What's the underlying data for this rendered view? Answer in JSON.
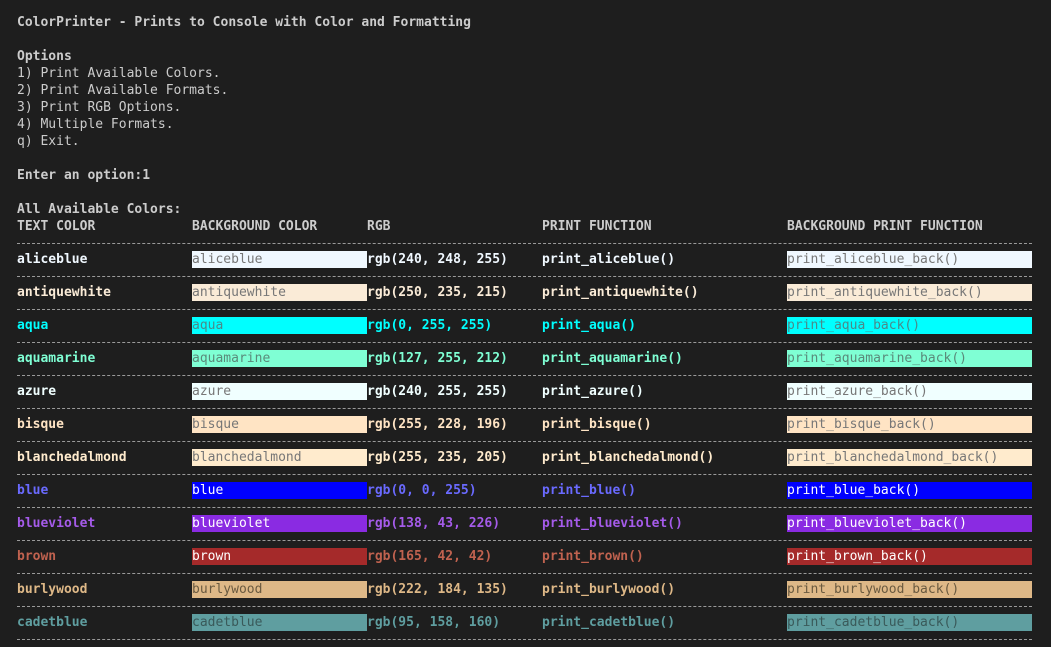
{
  "console": {
    "title": "ColorPrinter - Prints to Console with Color and Formatting",
    "options_heading": "Options",
    "options": [
      "1) Print Available Colors.",
      "2) Print Available Formats.",
      "3) Print RGB Options.",
      "4) Multiple Formats.",
      "q) Exit."
    ],
    "prompt": "Enter an option:1",
    "section_title": "All Available Colors:",
    "headers": [
      "TEXT COLOR",
      "BACKGROUND COLOR",
      "RGB",
      "PRINT FUNCTION",
      "BACKGROUND PRINT FUNCTION"
    ],
    "colors": [
      {
        "name": "aliceblue",
        "rgb": "rgb(240, 248, 255)",
        "print_fn": "print_aliceblue()",
        "back_fn": "print_aliceblue_back()",
        "hex": "#f0f8ff",
        "bg_text": "#777777"
      },
      {
        "name": "antiquewhite",
        "rgb": "rgb(250, 235, 215)",
        "print_fn": "print_antiquewhite()",
        "back_fn": "print_antiquewhite_back()",
        "hex": "#faebd7",
        "bg_text": "#777777"
      },
      {
        "name": "aqua",
        "rgb": "rgb(0, 255, 255)",
        "print_fn": "print_aqua()",
        "back_fn": "print_aqua_back()",
        "hex": "#00ffff",
        "bg_text": "#4a8a8a"
      },
      {
        "name": "aquamarine",
        "rgb": "rgb(127, 255, 212)",
        "print_fn": "print_aquamarine()",
        "back_fn": "print_aquamarine_back()",
        "hex": "#7fffd4",
        "bg_text": "#5a8a7a"
      },
      {
        "name": "azure",
        "rgb": "rgb(240, 255, 255)",
        "print_fn": "print_azure()",
        "back_fn": "print_azure_back()",
        "hex": "#f0ffff",
        "bg_text": "#777777"
      },
      {
        "name": "bisque",
        "rgb": "rgb(255, 228, 196)",
        "print_fn": "print_bisque()",
        "back_fn": "print_bisque_back()",
        "hex": "#ffe4c4",
        "bg_text": "#777777"
      },
      {
        "name": "blanchedalmond",
        "rgb": "rgb(255, 235, 205)",
        "print_fn": "print_blanchedalmond()",
        "back_fn": "print_blanchedalmond_back()",
        "hex": "#ffebcd",
        "bg_text": "#777777"
      },
      {
        "name": "blue",
        "rgb": "rgb(0, 0, 255)",
        "print_fn": "print_blue()",
        "back_fn": "print_blue_back()",
        "hex": "#0000ff",
        "fg": "#6a6aff",
        "bg_text": "#dddddd"
      },
      {
        "name": "blueviolet",
        "rgb": "rgb(138, 43, 226)",
        "print_fn": "print_blueviolet()",
        "back_fn": "print_blueviolet_back()",
        "hex": "#8a2be2",
        "fg": "#a55bea",
        "bg_text": "#dddddd"
      },
      {
        "name": "brown",
        "rgb": "rgb(165, 42, 42)",
        "print_fn": "print_brown()",
        "back_fn": "print_brown_back()",
        "hex": "#a52a2a",
        "fg": "#c0624f",
        "bg_text": "#dddddd"
      },
      {
        "name": "burlywood",
        "rgb": "rgb(222, 184, 135)",
        "print_fn": "print_burlywood()",
        "back_fn": "print_burlywood_back()",
        "hex": "#deb887",
        "bg_text": "#6a5a40"
      },
      {
        "name": "cadetblue",
        "rgb": "rgb(95, 158, 160)",
        "print_fn": "print_cadetblue()",
        "back_fn": "print_cadetblue_back()",
        "hex": "#5f9ea0",
        "bg_text": "#3a5a5a"
      }
    ]
  }
}
